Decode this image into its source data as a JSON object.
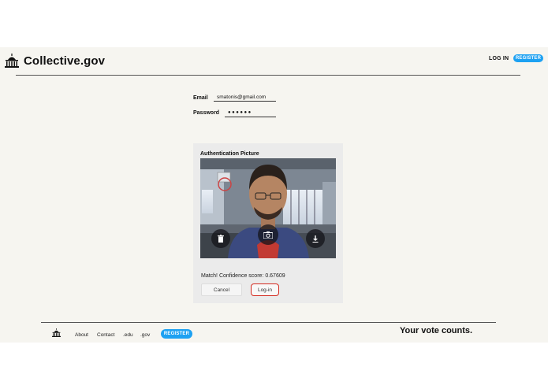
{
  "header": {
    "brand": "Collective.gov",
    "login_label": "LOG IN",
    "register_label": "REGISTER",
    "logo_icon": "capitol-building-icon"
  },
  "form": {
    "email_label": "Email",
    "email_value": "smatonis@gmail.com",
    "password_label": "Password",
    "password_value": "●●●●●●"
  },
  "auth": {
    "title": "Authentication Picture",
    "icons": [
      "trash-icon",
      "camera-icon",
      "download-icon"
    ],
    "match_text": "Match! Confidence score: 0.67609",
    "cancel_label": "Cancel",
    "login_label": "Log-in"
  },
  "footer": {
    "links": [
      "About",
      "Contact",
      ".edu",
      ".gov"
    ],
    "register_label": "REGISTER",
    "tagline": "Your vote counts."
  },
  "colors": {
    "accent": "#1da1f2",
    "highlight": "#d42a1f",
    "background": "#f6f5f0"
  }
}
